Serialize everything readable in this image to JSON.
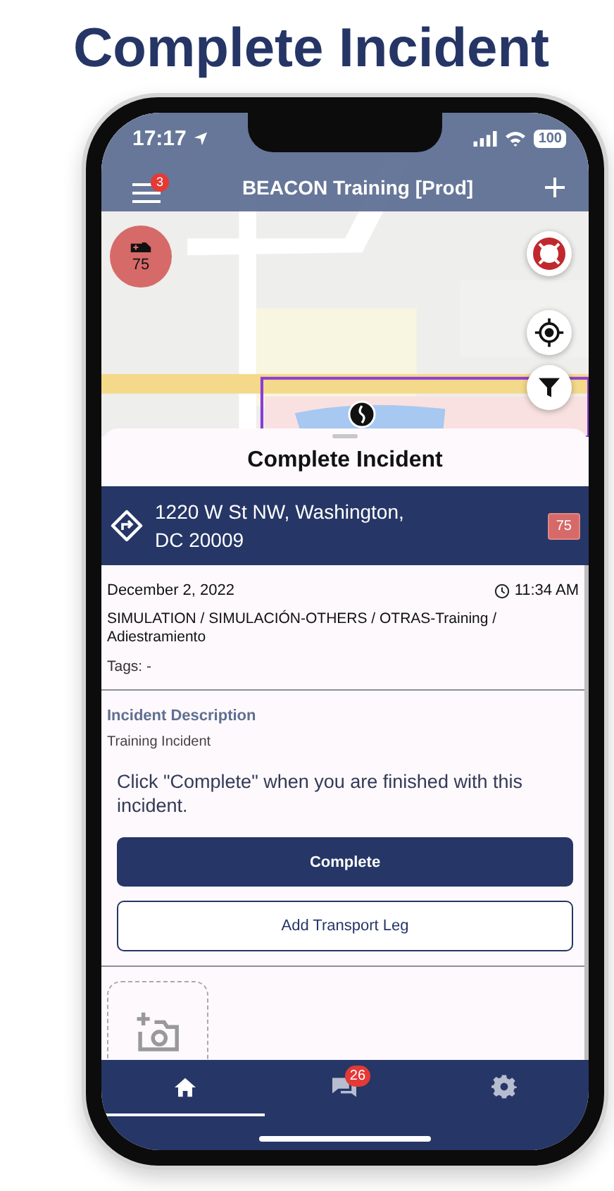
{
  "title": "Complete Incident",
  "status_bar": {
    "time": "17:17",
    "battery": "100"
  },
  "header": {
    "menu_badge": "3",
    "title": "BEACON Training [Prod]"
  },
  "map": {
    "kind": "picture",
    "cluster_count": "75"
  },
  "sheet": {
    "title": "Complete Incident",
    "address": "1220 W St NW, Washington, DC 20009",
    "priority": "75",
    "date": "December 2, 2022",
    "time": "11:34 AM",
    "type": "SIMULATION / SIMULACIÓN-OTHERS / OTRAS-Training / Adiestramiento",
    "tags": "Tags: -",
    "description_label": "Incident Description",
    "description": "Training Incident",
    "instruction": "Click \"Complete\" when you are finished with this incident.",
    "buttons": [
      {
        "label": "Complete",
        "kind": "primary"
      },
      {
        "label": "Add Transport Leg",
        "kind": "outline"
      }
    ]
  },
  "nav": [
    {
      "kind": "home",
      "selected": true
    },
    {
      "kind": "chat",
      "badge": "26",
      "selected": false
    },
    {
      "kind": "settings",
      "selected": false
    }
  ]
}
